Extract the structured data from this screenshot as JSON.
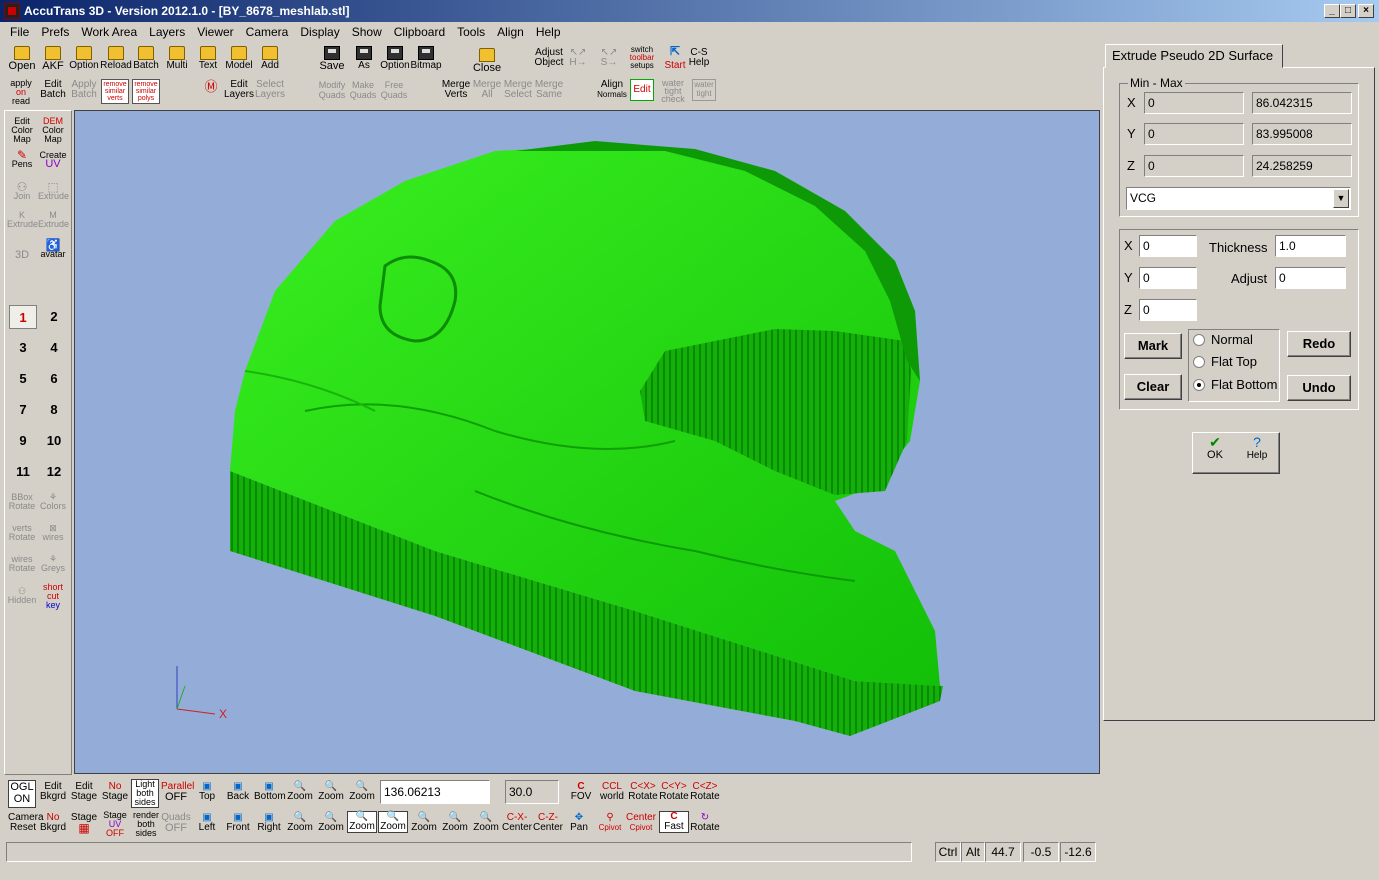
{
  "window": {
    "title": "AccuTrans 3D - Version 2012.1.0 - [BY_8678_meshlab.stl]",
    "controls": [
      "_",
      "□",
      "×"
    ]
  },
  "menu": [
    "File",
    "Prefs",
    "Work Area",
    "Layers",
    "Viewer",
    "Camera",
    "Display",
    "Show",
    "Clipboard",
    "Tools",
    "Align",
    "Help"
  ],
  "toolbar_top_row1": {
    "open": "Open",
    "akf": "AKF",
    "option": "Option",
    "reload": "Reload",
    "batch": "Batch",
    "multi": "Multi",
    "text": "Text",
    "model": "Model",
    "add": "Add",
    "save": "Save",
    "as": "As",
    "option2": "Option",
    "bitmap": "Bitmap",
    "close": "Close",
    "adjust_object": [
      "Adjust",
      "Object"
    ],
    "switch_toolbar": [
      "switch",
      "toolbar",
      "setups"
    ],
    "start": "Start",
    "cs_help": [
      "C-S",
      "Help"
    ]
  },
  "toolbar_top_row2": {
    "apply_on_read": [
      "apply",
      "on",
      "read"
    ],
    "edit_batch": [
      "Edit",
      "Batch"
    ],
    "apply_batch": [
      "Apply",
      "Batch"
    ],
    "remove_similar_verts": [
      "remove",
      "similar",
      "verts"
    ],
    "remove_similar_polys": [
      "remove",
      "similar",
      "polys"
    ],
    "edit_layers": [
      "Edit",
      "Layers"
    ],
    "select_layers": [
      "Select",
      "Layers"
    ],
    "modify_quads": [
      "Modify",
      "Quads"
    ],
    "make_quads": [
      "Make",
      "Quads"
    ],
    "free_quads": [
      "Free",
      "Quads"
    ],
    "merge_verts": [
      "Merge",
      "Verts"
    ],
    "merge_all": [
      "Merge",
      "All"
    ],
    "merge_select": [
      "Merge",
      "Select"
    ],
    "merge_same": [
      "Merge",
      "Same"
    ],
    "align_normals": [
      "Align",
      "Normals"
    ],
    "edit": "Edit",
    "water_tight_check": [
      "water",
      "tight",
      "check"
    ],
    "water_tight": [
      "water",
      "tight"
    ]
  },
  "left_toolbar": {
    "edit_color_map": [
      "Edit",
      "Color",
      "Map"
    ],
    "dem_color_map": [
      "DEM",
      "Color",
      "Map"
    ],
    "pens": "Pens",
    "create_uv": [
      "Create",
      "UV"
    ],
    "join": "Join",
    "extrude": "Extrude",
    "extrude_k": [
      "K",
      "Extrude"
    ],
    "extrude_m": [
      "M",
      "Extrude"
    ],
    "to_3d": "3D",
    "avatar": "avatar",
    "numbers": [
      "1",
      "2",
      "3",
      "4",
      "5",
      "6",
      "7",
      "8",
      "9",
      "10",
      "11",
      "12"
    ],
    "bbox_rotate": [
      "BBox",
      "Rotate"
    ],
    "colors": "Colors",
    "verts_rotate": [
      "verts",
      "Rotate"
    ],
    "wires": "wires",
    "wires_rotate": [
      "wires",
      "Rotate"
    ],
    "greys": "Greys",
    "hidden": "Hidden",
    "shortcut_key": [
      "short",
      "cut",
      "key"
    ]
  },
  "viewport": {
    "background_color": "#94acd8",
    "mesh_color": "#22e010",
    "axis_x_label": "X"
  },
  "panel": {
    "tab_label": "Extrude Pseudo 2D Surface",
    "minmax_label": "Min - Max",
    "rows": [
      {
        "axis": "X",
        "min": "0",
        "max": "86.042315"
      },
      {
        "axis": "Y",
        "min": "0",
        "max": "83.995008"
      },
      {
        "axis": "Z",
        "min": "0",
        "max": "24.258259"
      }
    ],
    "dropdown_value": "VCG",
    "x_label": "X",
    "x_value": "0",
    "y_label": "Y",
    "y_value": "0",
    "z_label": "Z",
    "z_value": "0",
    "thickness_label": "Thickness",
    "thickness_value": "1.0",
    "adjust_label": "Adjust",
    "adjust_value": "0",
    "mark": "Mark",
    "clear": "Clear",
    "redo": "Redo",
    "undo": "Undo",
    "radio_normal": "Normal",
    "radio_flat_top": "Flat Top",
    "radio_flat_bottom": "Flat Bottom",
    "selected_radio": "Flat Bottom",
    "ok": "OK",
    "help": "Help"
  },
  "bottom_toolbar": {
    "ogl": [
      "OGL",
      "ON"
    ],
    "edit_bkgrd": [
      "Edit",
      "Bkgrd"
    ],
    "edit_stage": [
      "Edit",
      "Stage"
    ],
    "no_stage": [
      "No",
      "Stage"
    ],
    "light_both_sides": [
      "Light",
      "both",
      "sides"
    ],
    "parallel_off": [
      "Parallel",
      "OFF"
    ],
    "top": "Top",
    "back": "Back",
    "bottom": "Bottom",
    "zoom1": "Zoom",
    "zoom2": "Zoom",
    "zoom3": "Zoom",
    "camera_reset": [
      "Camera",
      "Reset"
    ],
    "no_bkgrd": [
      "No",
      "Bkgrd"
    ],
    "stage_uv_off": [
      "Stage",
      "UV",
      "OFF"
    ],
    "render_both_sides": [
      "render",
      "both",
      "sides"
    ],
    "quads_off": [
      "Quads",
      "OFF"
    ],
    "left": "Left",
    "front": "Front",
    "right": "Right",
    "zoom4": "Zoom",
    "zoom5": "Zoom",
    "zoom6": "Zoom",
    "zoom_a": "Zoom",
    "zoom_in": "Zoom",
    "zoom_out": "Zoom",
    "zoom_c": "Zoom",
    "center_x": "Center",
    "center_z": "Center",
    "pan": "Pan",
    "fov": "FOV",
    "world": "world",
    "rotate_x": "Rotate",
    "rotate_y": "Rotate",
    "rotate_z": "Rotate",
    "center_pivot": [
      "Center",
      "Cpivot"
    ],
    "fast": "Fast",
    "rotate_c": "Rotate",
    "cpivot": "Cpivot",
    "zoom_value": "136.06213",
    "fov_value": "30.0",
    "c_labels": [
      "C",
      "C-X-",
      "C-Z-",
      "C<X>",
      "C<Y>",
      "C<Z>"
    ]
  },
  "status": {
    "ctrl": "Ctrl",
    "alt": "Alt",
    "v1": "44.7",
    "v2": "-0.5",
    "v3": "-12.6"
  }
}
